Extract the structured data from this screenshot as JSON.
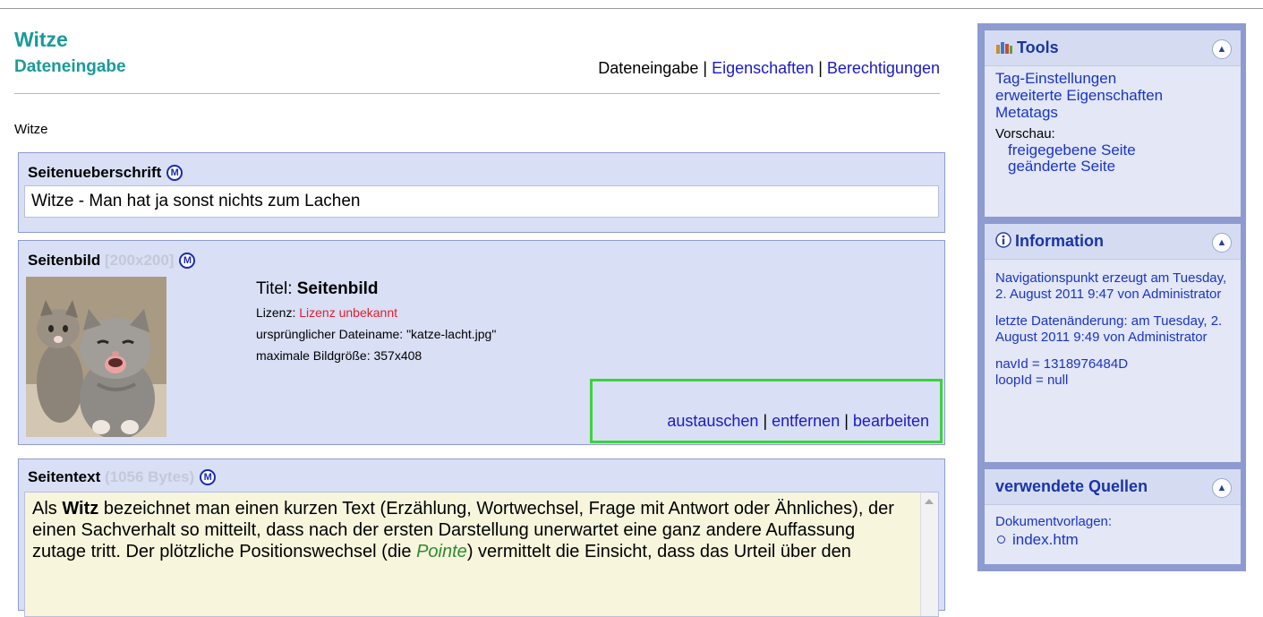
{
  "header": {
    "app_title": "Witze",
    "page_subtitle": "Dateneingabe",
    "nav": {
      "current": "Dateneingabe",
      "separator": "|",
      "link_properties": "Eigenschaften",
      "link_permissions": "Berechtigungen"
    },
    "breadcrumb": "Witze"
  },
  "heading_panel": {
    "label": "Seitenueberschrift",
    "m_icon": "M",
    "value": "Witze - Man hat ja sonst nichts zum Lachen"
  },
  "image_panel": {
    "label": "Seitenbild",
    "size_hint": "[200x200]",
    "m_icon": "M",
    "image_icon": "kitten-photo",
    "title_label": "Titel:",
    "title_value": "Seitenbild",
    "license_label": "Lizenz:",
    "license_value": "Lizenz unbekannt",
    "filename_line": "ursprünglicher Dateiname: \"katze-lacht.jpg\"",
    "maxsize_line": "maximale Bildgröße: 357x408",
    "actions": {
      "replace": "austauschen",
      "remove": "entfernen",
      "edit": "bearbeiten",
      "separator": "|"
    },
    "highlight_color": "#3cd23c"
  },
  "text_panel": {
    "label": "Seitentext",
    "size_hint": "(1056 Bytes)",
    "m_icon": "M",
    "text_parts": {
      "p1": "Als ",
      "bold": "Witz",
      "p2": " bezeichnet man einen kurzen Text (Erzählung, Wortwechsel, Frage mit Antwort oder Ähnliches), der einen Sachverhalt so mitteilt, dass nach der ersten Darstellung unerwartet eine ganz andere Auffassung zutage tritt. Der plötzliche Positionswechsel (die ",
      "italic": "Pointe",
      "p3": ") vermittelt die Einsicht, dass das Urteil über den"
    }
  },
  "sidebar": {
    "tools": {
      "title": "Tools",
      "icon": "tools-icon",
      "links": [
        "Tag-Einstellungen",
        "erweiterte Eigenschaften",
        "Metatags"
      ],
      "preview_label": "Vorschau:",
      "preview_links": [
        "freigegebene Seite",
        "geänderte Seite"
      ]
    },
    "information": {
      "title": "Information",
      "icon": "info-icon",
      "created": "Navigationspunkt erzeugt am Tuesday, 2. August 2011 9:47 von Administrator",
      "changed": "letzte Datenänderung: am Tuesday, 2. August 2011 9:49 von Administrator",
      "navid": "navId = 1318976484D",
      "loopid": "loopId = null"
    },
    "sources": {
      "title": "verwendete Quellen",
      "label": "Dokumentvorlagen:",
      "item": "index.htm"
    }
  },
  "colors": {
    "accent_teal": "#1a9a9a",
    "link_blue": "#1a1ac8",
    "panel_bg": "#d9dff5",
    "sidebar_bg": "#8d9bd0",
    "license_red": "#e02030",
    "text_bg": "#f7f5dc"
  }
}
